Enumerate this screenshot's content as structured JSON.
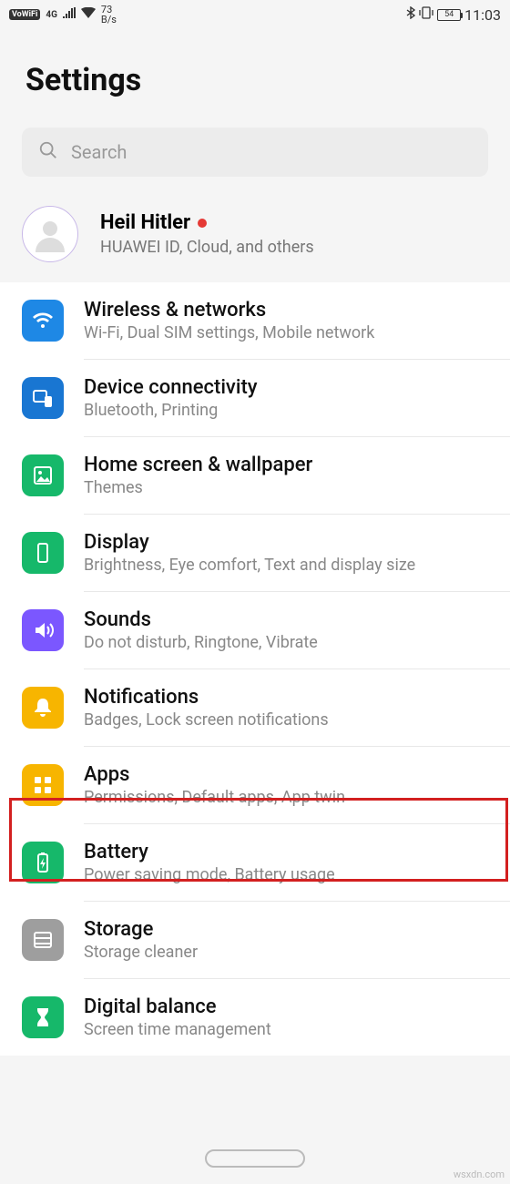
{
  "status": {
    "vowifi": "VoWiFi",
    "net": "4G",
    "speed_top": "73",
    "speed_bottom": "B/s",
    "battery": "54",
    "time": "11:03"
  },
  "header": {
    "title": "Settings"
  },
  "search": {
    "placeholder": "Search"
  },
  "account": {
    "name": "Heil Hitler",
    "sub": "HUAWEI ID, Cloud, and others"
  },
  "items": [
    {
      "icon": "wifi-icon",
      "color": "c-blue",
      "title": "Wireless & networks",
      "sub": "Wi-Fi, Dual SIM settings, Mobile network"
    },
    {
      "icon": "connect-icon",
      "color": "c-blue2",
      "title": "Device connectivity",
      "sub": "Bluetooth, Printing"
    },
    {
      "icon": "wallpaper-icon",
      "color": "c-green",
      "title": "Home screen & wallpaper",
      "sub": "Themes"
    },
    {
      "icon": "display-icon",
      "color": "c-green",
      "title": "Display",
      "sub": "Brightness, Eye comfort, Text and display size"
    },
    {
      "icon": "sound-icon",
      "color": "c-purple",
      "title": "Sounds",
      "sub": "Do not disturb, Ringtone, Vibrate"
    },
    {
      "icon": "bell-icon",
      "color": "c-yellow",
      "title": "Notifications",
      "sub": "Badges, Lock screen notifications"
    },
    {
      "icon": "apps-icon",
      "color": "c-yellow",
      "title": "Apps",
      "sub": "Permissions, Default apps, App twin"
    },
    {
      "icon": "battery-icon",
      "color": "c-green2",
      "title": "Battery",
      "sub": "Power saving mode, Battery usage"
    },
    {
      "icon": "storage-icon",
      "color": "c-grey",
      "title": "Storage",
      "sub": "Storage cleaner"
    },
    {
      "icon": "hourglass-icon",
      "color": "c-green",
      "title": "Digital balance",
      "sub": "Screen time management"
    }
  ],
  "watermark": "wsxdn.com"
}
